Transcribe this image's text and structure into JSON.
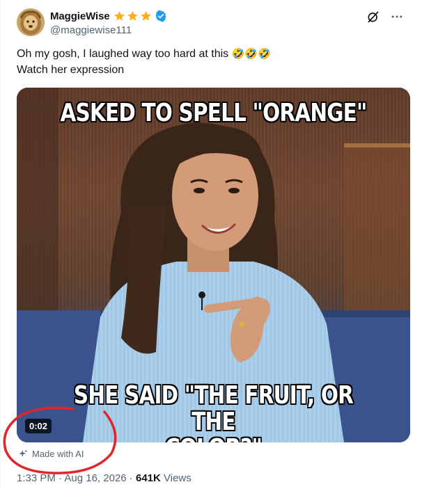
{
  "author": {
    "display_name": "MaggieWise",
    "handle": "@maggiewise111",
    "verified": true,
    "rating_stars": 3,
    "star_color": "#ffad1f",
    "verified_color": "#1d9bf0"
  },
  "tweet": {
    "text_line_1": "Oh my gosh, I laughed way too hard at this",
    "emoji": "🤣🤣🤣",
    "text_line_2": "Watch her expression"
  },
  "media": {
    "meme_top": "ASKED TO SPELL \"ORANGE\"",
    "meme_bottom_line_1": "SHE SAID \"THE FRUIT, OR THE",
    "meme_bottom_line_2": "COLOR?\"",
    "video_time": "0:02"
  },
  "ai_label": {
    "text": "Made with AI",
    "icon": "sparkle-icon"
  },
  "meta": {
    "time": "1:33 PM",
    "separator": " · ",
    "date": "Aug 16, 2026",
    "views_count": "641K",
    "views_label": "Views"
  },
  "icons": {
    "grok": "grok-icon",
    "more": "more-icon"
  },
  "annotation_color": "#e0262b"
}
